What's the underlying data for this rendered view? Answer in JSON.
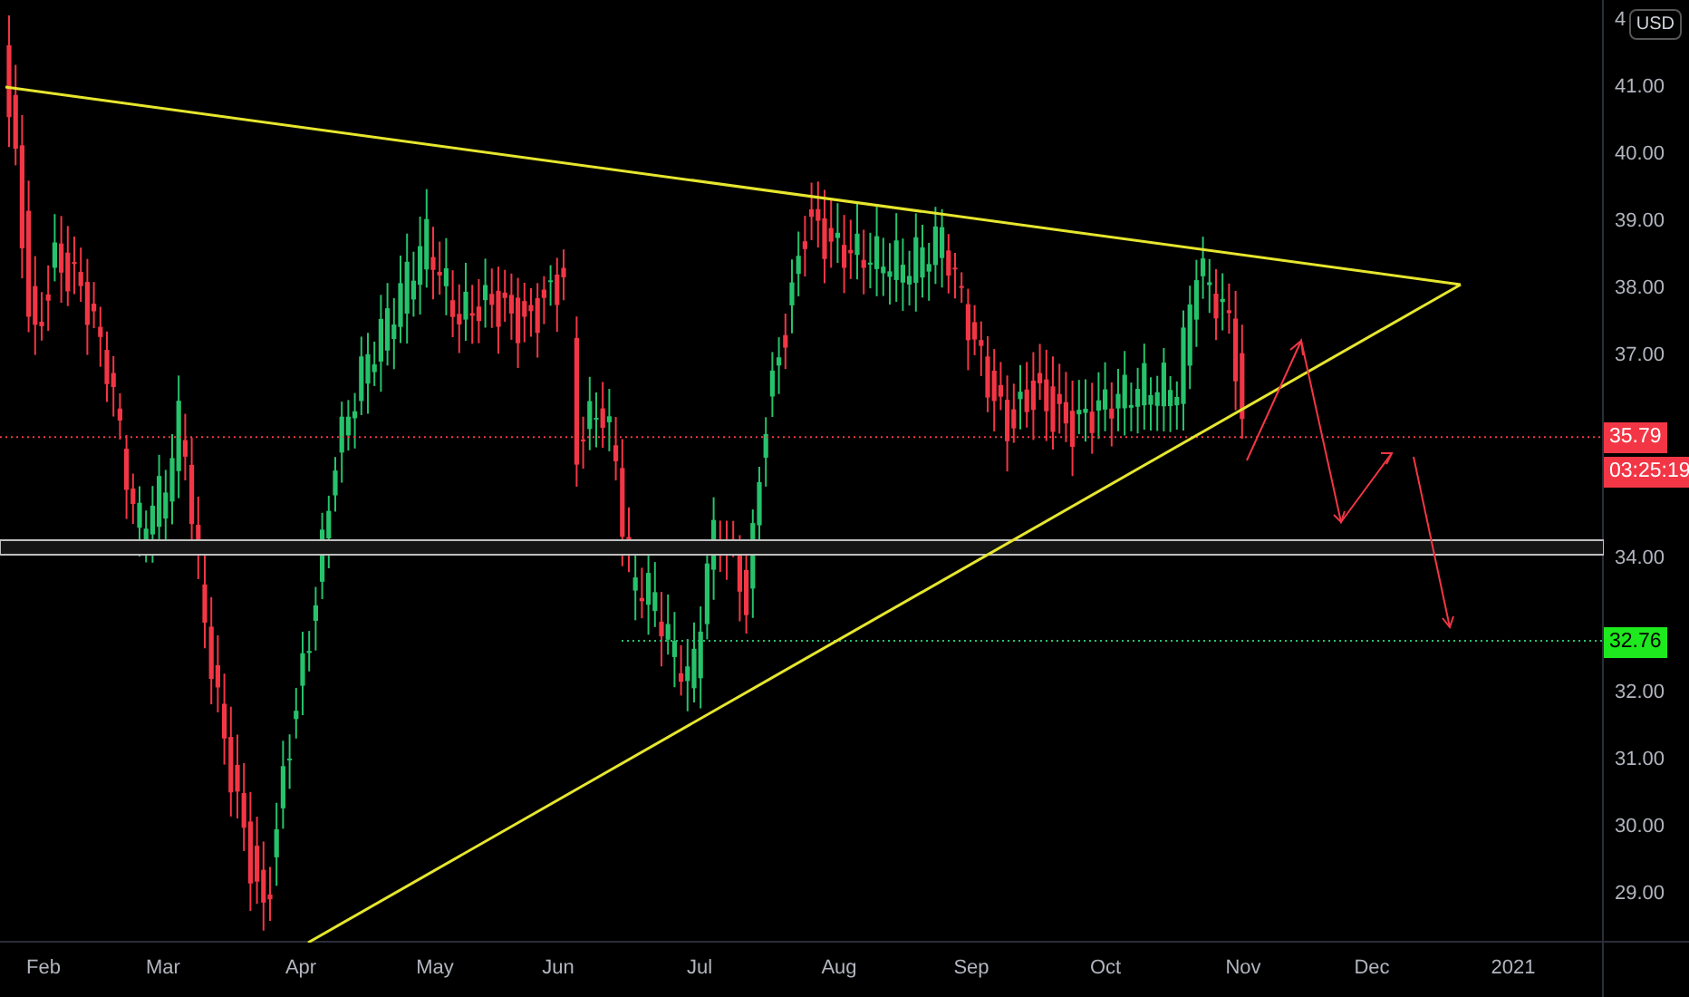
{
  "chart": {
    "currency": "USD",
    "price_labels": [
      "4",
      "41.00",
      "40.00",
      "39.00",
      "38.00",
      "37.00",
      "34.00",
      "32.00",
      "31.00",
      "30.00",
      "29.00"
    ],
    "last_price": {
      "label": "35.79",
      "countdown": "03:25:19"
    },
    "target_price": {
      "label": "32.76"
    },
    "time_labels": [
      "Feb",
      "Mar",
      "Apr",
      "May",
      "Jun",
      "Jul",
      "Aug",
      "Sep",
      "Oct",
      "Nov",
      "Dec",
      "2021"
    ]
  }
}
